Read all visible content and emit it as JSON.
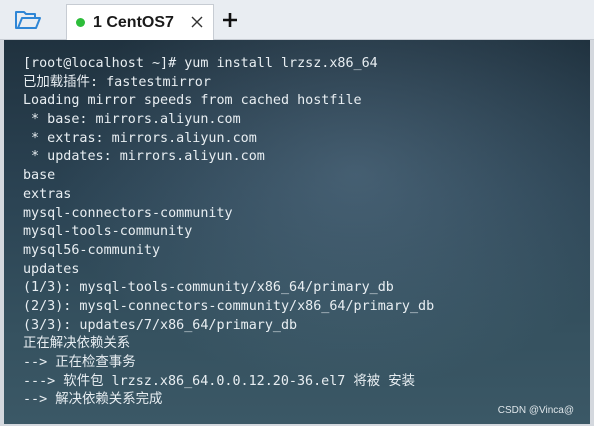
{
  "toolbar": {
    "open_icon": "folder-open-icon"
  },
  "tabs": [
    {
      "label": "1 CentOS7",
      "status_color": "#2dbd3a",
      "close_icon": "close-icon"
    }
  ],
  "new_tab_icon": "plus-icon",
  "terminal": {
    "lines": [
      "[root@localhost ~]# yum install lrzsz.x86_64",
      "已加载插件: fastestmirror",
      "Loading mirror speeds from cached hostfile",
      " * base: mirrors.aliyun.com",
      " * extras: mirrors.aliyun.com",
      " * updates: mirrors.aliyun.com",
      "base",
      "extras",
      "mysql-connectors-community",
      "mysql-tools-community",
      "mysql56-community",
      "updates",
      "(1/3): mysql-tools-community/x86_64/primary_db",
      "(2/3): mysql-connectors-community/x86_64/primary_db",
      "(3/3): updates/7/x86_64/primary_db",
      "正在解决依赖关系",
      "--> 正在检查事务",
      "---> 软件包 lrzsz.x86_64.0.0.12.20-36.el7 将被 安装",
      "--> 解决依赖关系完成"
    ]
  },
  "watermark": "CSDN @Vinca@"
}
